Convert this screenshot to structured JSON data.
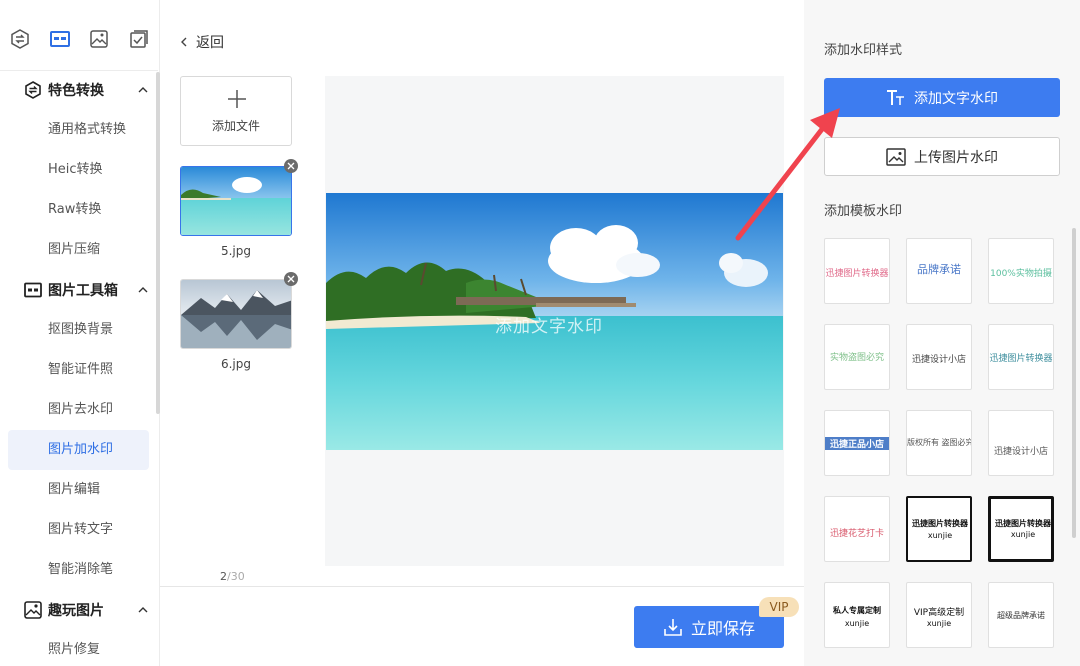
{
  "sidebar": {
    "sections": [
      {
        "label": "特色转换",
        "icon": "exchange-icon"
      },
      {
        "label": "图片工具箱",
        "icon": "toolbox-icon"
      },
      {
        "label": "趣玩图片",
        "icon": "image-fun-icon"
      }
    ],
    "items": [
      "通用格式转换",
      "Heic转换",
      "Raw转换",
      "图片压缩",
      "抠图换背景",
      "智能证件照",
      "图片去水印",
      "图片加水印",
      "图片编辑",
      "图片转文字",
      "智能消除笔",
      "照片修复"
    ],
    "active_item": "图片加水印"
  },
  "main": {
    "back_label": "返回",
    "add_file_label": "添加文件",
    "files": [
      {
        "name": "5.jpg",
        "selected": true
      },
      {
        "name": "6.jpg",
        "selected": false
      }
    ],
    "page_current": "2",
    "page_total": "/30",
    "watermark_text": "添加文字水印",
    "save_label": "立即保存",
    "vip_label": "VIP"
  },
  "right_panel": {
    "style_title": "添加水印样式",
    "text_wm_button": "添加文字水印",
    "image_wm_button": "上传图片水印",
    "template_title": "添加模板水印",
    "templates": [
      {
        "label": "迅捷图片转换器"
      },
      {
        "label": "品牌承诺"
      },
      {
        "label": "100%实物拍摄"
      },
      {
        "label": "实物盗图必究"
      },
      {
        "label": "迅捷设计小店"
      },
      {
        "label": "迅捷图片转换器"
      },
      {
        "label": "迅捷正品小店"
      },
      {
        "label": "版权所有 盗图必究"
      },
      {
        "label": "迅捷设计小店"
      },
      {
        "label": "迅捷花艺打卡"
      },
      {
        "label": "迅捷图片转换器",
        "sub": "xunjie"
      },
      {
        "label": "迅捷图片转换器",
        "sub": "xunjie"
      },
      {
        "label": "私人专属定制",
        "sub": "xunjie"
      },
      {
        "label": "VIP高级定制",
        "sub": "xunjie"
      },
      {
        "label": "超级品牌承诺"
      }
    ]
  },
  "colors": {
    "accent": "#3d7cf0",
    "arrow": "#f0434e",
    "active_bg": "#eef2fb"
  }
}
